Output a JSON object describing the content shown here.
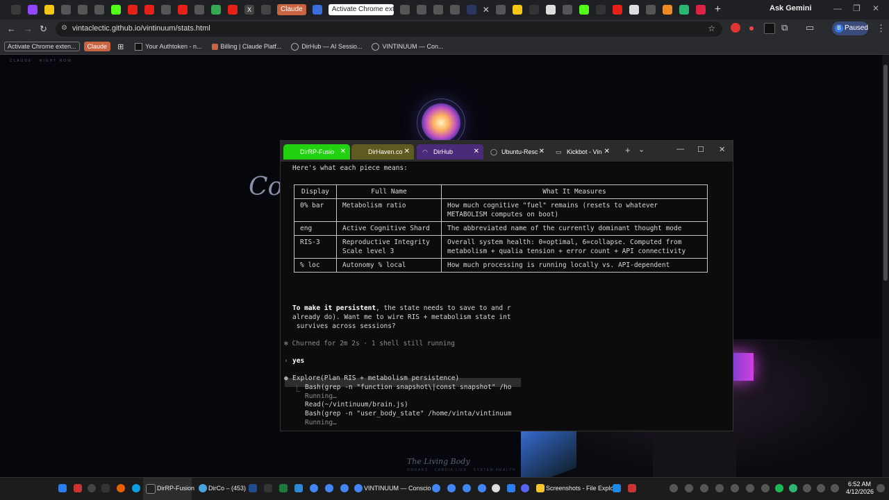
{
  "browser": {
    "tab_claude": "Claude",
    "tab_active": "Activate Chrome exte",
    "ask_gemini": "Ask Gemini",
    "url": "vintaclectic.github.io/vintinuum/stats.html",
    "profile_initial": "B",
    "profile_status": "Paused"
  },
  "bookmarks": [
    {
      "label": "Activate Chrome exten..."
    },
    {
      "label": "Claude"
    },
    {
      "label": "Your Authtoken - n..."
    },
    {
      "label": "Billing | Claude Platf..."
    },
    {
      "label": "DirHub — AI Sessio..."
    },
    {
      "label": "VINTINUUM — Con..."
    }
  ],
  "page": {
    "kicker": "CLAUDE · RIGHT NOW",
    "title_partial": "Co",
    "footer_title": "The Living Body",
    "footer_sub": "ORGANS · CARDIA LIFE · SYSTEM HEALTH"
  },
  "terminal": {
    "tabs": [
      {
        "label": "DirRP-Fusio",
        "color": "#22d10f"
      },
      {
        "label": "DirHaven.co",
        "color": "#5e5a20"
      },
      {
        "label": "DirHub",
        "color": "#4b2a7a"
      },
      {
        "label": "Ubuntu-Resc",
        "color": "#2b2b2b"
      },
      {
        "label": "Kickbot - Vin",
        "color": "#2b2b2b"
      }
    ],
    "intro": "Here's what each piece means:",
    "table": {
      "headers": [
        "Display",
        "Full Name",
        "What It Measures"
      ],
      "rows": [
        [
          "0% bar",
          "Metabolism ratio",
          "How much cognitive \"fuel\" remains (resets to whatever METABOLISM computes on boot)"
        ],
        [
          "eng",
          "Active Cognitive Shard",
          "The abbreviated name of the currently dominant thought mode"
        ],
        [
          "RIS-3",
          "Reproductive Integrity Scale level 3",
          "Overall system health: 0=optimal, 6=collapse. Computed from metabolism + qualia tension + error count + API connectivity"
        ],
        [
          "% loc",
          "Autonomy % local",
          "How much processing is running locally vs. API-dependent"
        ]
      ]
    },
    "persist_bold": "To make it persistent",
    "persist_1": ", the state needs to save to and r",
    "persist_2": "already do). Want me to wire RIS + metabolism state int",
    "persist_3": " survives across sessions?",
    "churned": "✻ Churned for 2m 2s · 1 shell still running",
    "prompt_user": "yes",
    "explore": "Explore(Plan RIS + metabolism persistence)",
    "sub1": "Bash(grep -n \"function snapshot\\|const snapshot\" /ho",
    "running1": "Running…",
    "sub2": "Read(~/vintinuum/brain.js)",
    "sub3": "Bash(grep -n \"user_body_state\" /home/vinta/vintinuum",
    "running2": "Running…"
  },
  "taskbar": {
    "app_active": "DirRP-Fusion",
    "app_dirco": "DirCo – (453)",
    "app_vintinuum": "VINTINUUM — Conscio",
    "app_screenshots": "Screenshots - File Explo",
    "time": "6:52 AM",
    "date": "4/12/2026"
  }
}
